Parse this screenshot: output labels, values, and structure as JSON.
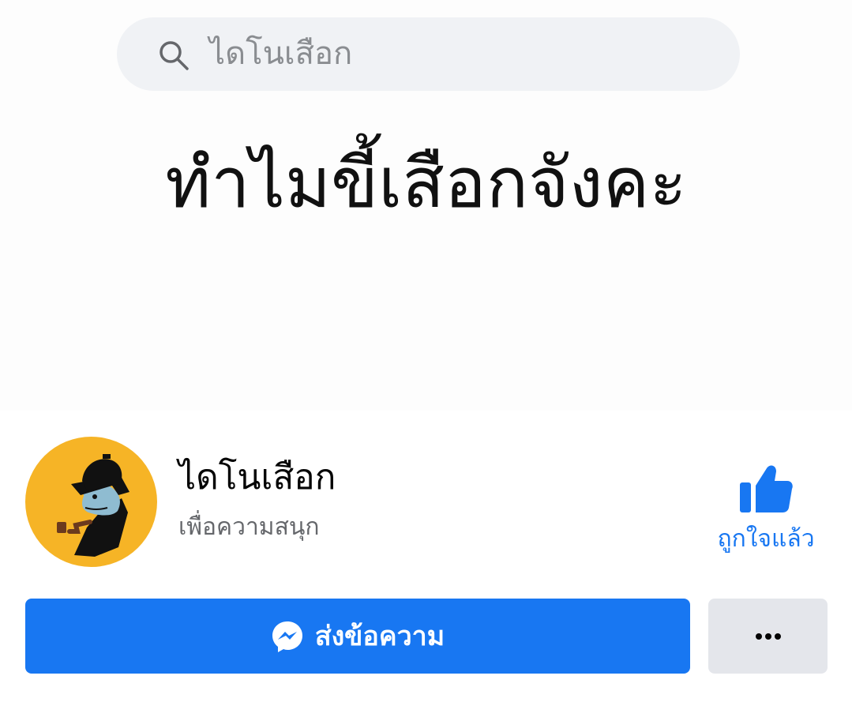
{
  "search": {
    "text": "ไดโนเสือก",
    "icon": "search-icon"
  },
  "cover": {
    "text": "ทำไมขี้เสือกจังคะ",
    "background": "#fdfdfd"
  },
  "page": {
    "name": "ไดโนเสือก",
    "category": "เพื่อความสนุก",
    "avatar_background": "#f6b426"
  },
  "like": {
    "label": "ถูกใจแล้ว",
    "icon": "thumbs-up-icon",
    "color": "#1877f2"
  },
  "message_button": {
    "label": "ส่งข้อความ",
    "icon": "messenger-icon",
    "color": "#1877f2"
  },
  "more_button": {
    "icon": "more-dots-icon"
  }
}
